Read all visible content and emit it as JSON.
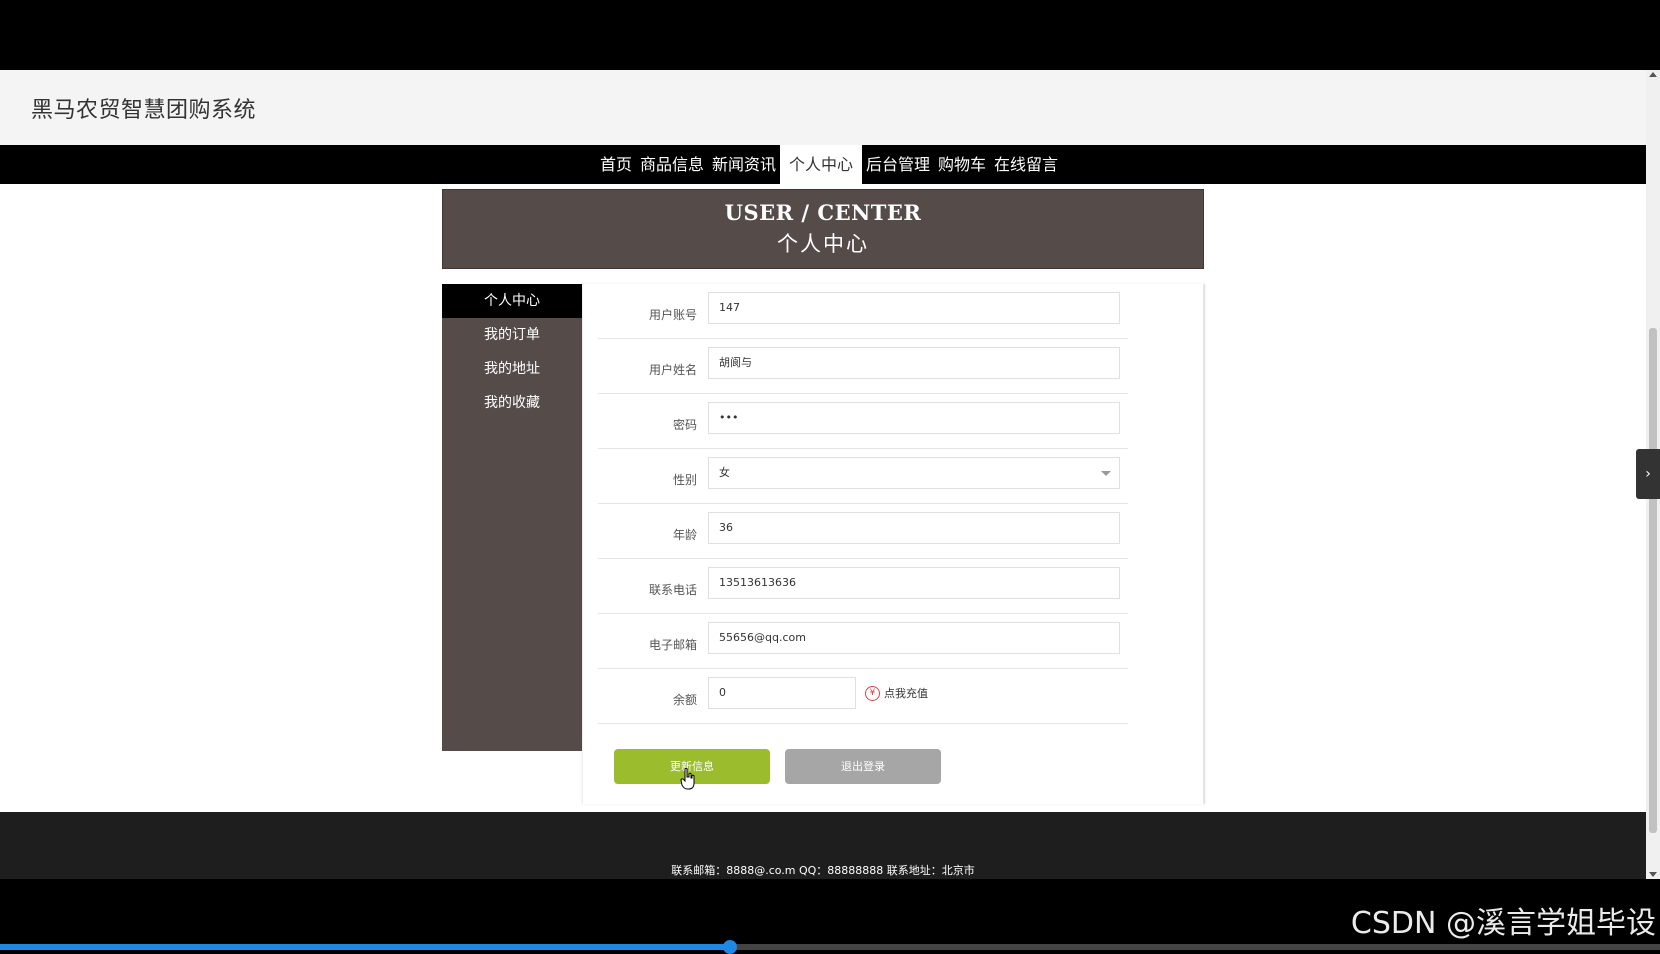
{
  "site": {
    "title": "黑马农贸智慧团购系统"
  },
  "nav": {
    "items": [
      "首页",
      "商品信息",
      "新闻资讯",
      "个人中心",
      "后台管理",
      "购物车",
      "在线留言"
    ],
    "active_index": 3
  },
  "banner": {
    "en": "USER / CENTER",
    "zh": "个人中心"
  },
  "sidebar": {
    "items": [
      "个人中心",
      "我的订单",
      "我的地址",
      "我的收藏"
    ],
    "active_index": 0
  },
  "form": {
    "fields": [
      {
        "label": "用户账号",
        "value": "147"
      },
      {
        "label": "用户姓名",
        "value": "胡阆与"
      },
      {
        "label": "密码",
        "value": "•••"
      },
      {
        "label": "性别",
        "value": "女"
      },
      {
        "label": "年龄",
        "value": "36"
      },
      {
        "label": "联系电话",
        "value": "13513613636"
      },
      {
        "label": "电子邮箱",
        "value": "55656@qq.com"
      },
      {
        "label": "余额",
        "value": "0"
      }
    ],
    "recharge_label": "点我充值",
    "recharge_icon": "yen-icon",
    "update_button": "更新信息",
    "logout_button": "退出登录"
  },
  "footer": {
    "text": "联系邮箱：8888@.co.m QQ：88888888 联系地址：北京市"
  },
  "watermark": "CSDN @溪言学姐毕设",
  "video": {
    "progress": 0.44
  },
  "colors": {
    "accent_green": "#9abc2d",
    "banner_brown": "#554c4a",
    "progress_blue": "#1e88e5"
  }
}
